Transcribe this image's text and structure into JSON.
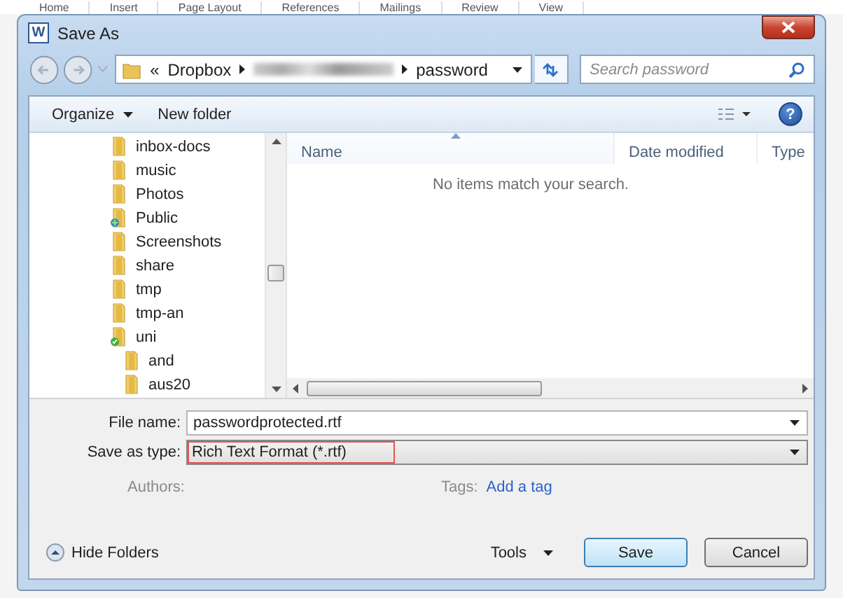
{
  "background_tabs": [
    "Home",
    "Insert",
    "Page Layout",
    "References",
    "Mailings",
    "Review",
    "View"
  ],
  "window": {
    "title": "Save As",
    "app_icon": "W"
  },
  "help": "?",
  "address": {
    "overflow_mark": "«",
    "segments": [
      {
        "kind": "text",
        "label": "Dropbox"
      },
      {
        "kind": "redacted"
      },
      {
        "kind": "text",
        "label": "password"
      }
    ]
  },
  "search": {
    "placeholder": "Search password"
  },
  "toolbar": {
    "organize": "Organize",
    "new_folder": "New folder"
  },
  "tree": [
    {
      "label": "inbox-docs",
      "kind": "folder"
    },
    {
      "label": "music",
      "kind": "folder"
    },
    {
      "label": "Photos",
      "kind": "folder"
    },
    {
      "label": "Public",
      "kind": "shared"
    },
    {
      "label": "Screenshots",
      "kind": "folder"
    },
    {
      "label": "share",
      "kind": "folder"
    },
    {
      "label": "tmp",
      "kind": "folder"
    },
    {
      "label": "tmp-an",
      "kind": "folder"
    },
    {
      "label": "uni",
      "kind": "synced",
      "children": [
        {
          "label": "and",
          "kind": "folder"
        },
        {
          "label": "aus20",
          "kind": "folder"
        }
      ]
    }
  ],
  "columns": [
    {
      "label": "Name",
      "sorted": true
    },
    {
      "label": "Date modified",
      "sorted": false
    },
    {
      "label": "Type",
      "sorted": false
    }
  ],
  "empty_message": "No items match your search.",
  "fields": [
    {
      "label": "File name:",
      "value": "passwordprotected.rtf",
      "kind": "combo",
      "highlighted": false
    },
    {
      "label": "Save as type:",
      "value": "Rich Text Format (*.rtf)",
      "kind": "select",
      "highlighted": true
    }
  ],
  "meta": [
    {
      "label": "Authors:"
    },
    {
      "label": "Tags:",
      "link": "Add a tag"
    }
  ],
  "hide_folders": "Hide Folders",
  "tools": "Tools",
  "buttons": [
    {
      "label": "Save",
      "default": true
    },
    {
      "label": "Cancel",
      "default": false
    }
  ]
}
